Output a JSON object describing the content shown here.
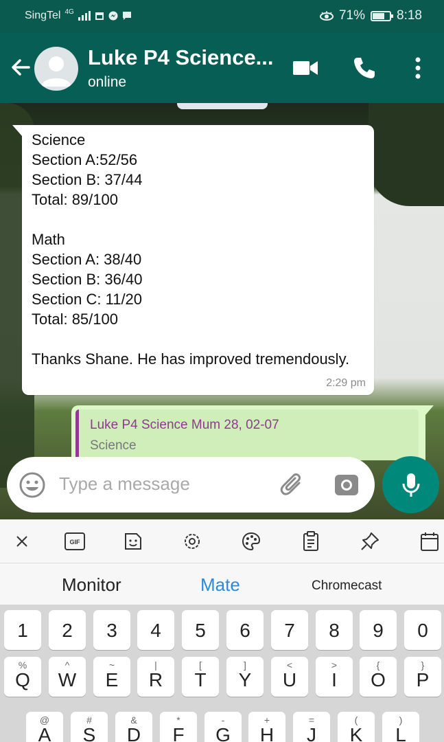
{
  "status_bar": {
    "carrier": "SingTel",
    "network": "4G",
    "battery": "71%",
    "battery_level": 0.71,
    "time": "8:18"
  },
  "header": {
    "chat_name": "Luke P4 Science...",
    "status": "online",
    "icons": [
      "back-arrow-icon",
      "video-call-icon",
      "phone-icon",
      "more-options-icon"
    ]
  },
  "messages": [
    {
      "direction": "incoming",
      "text": "Science\nSection A:52/56\nSection B: 37/44\nTotal: 89/100\n\nMath\nSection A: 38/40\nSection B: 36/40\nSection C: 11/20\nTotal: 85/100\n\nThanks Shane. He has improved tremendously.",
      "time": "2:29 pm"
    },
    {
      "direction": "outgoing",
      "quote_author": "Luke P4 Science Mum 28, 02-07",
      "quote_text": "Science"
    }
  ],
  "composer": {
    "placeholder": "Type a message",
    "value": ""
  },
  "keyboard": {
    "toolbar": [
      "close-icon",
      "gif-icon",
      "sticker-icon",
      "settings-icon",
      "theme-icon",
      "clipboard-icon",
      "pin-icon",
      "calendar-icon"
    ],
    "toolbar_gif_label": "GIF",
    "suggestions": [
      "Monitor",
      "Mate",
      "Chromecast"
    ],
    "number_row": [
      "1",
      "2",
      "3",
      "4",
      "5",
      "6",
      "7",
      "8",
      "9",
      "0"
    ],
    "row1": [
      {
        "key": "Q",
        "alt": "%"
      },
      {
        "key": "W",
        "alt": "^"
      },
      {
        "key": "E",
        "alt": "~"
      },
      {
        "key": "R",
        "alt": "|"
      },
      {
        "key": "T",
        "alt": "["
      },
      {
        "key": "Y",
        "alt": "]"
      },
      {
        "key": "U",
        "alt": "<"
      },
      {
        "key": "I",
        "alt": ">"
      },
      {
        "key": "O",
        "alt": "{"
      },
      {
        "key": "P",
        "alt": "}"
      }
    ],
    "row2": [
      {
        "key": "A",
        "alt": "@"
      },
      {
        "key": "S",
        "alt": "#"
      },
      {
        "key": "D",
        "alt": "&"
      },
      {
        "key": "F",
        "alt": "*"
      },
      {
        "key": "G",
        "alt": "-"
      },
      {
        "key": "H",
        "alt": "+"
      },
      {
        "key": "J",
        "alt": "="
      },
      {
        "key": "K",
        "alt": "("
      },
      {
        "key": "L",
        "alt": ")"
      }
    ]
  }
}
